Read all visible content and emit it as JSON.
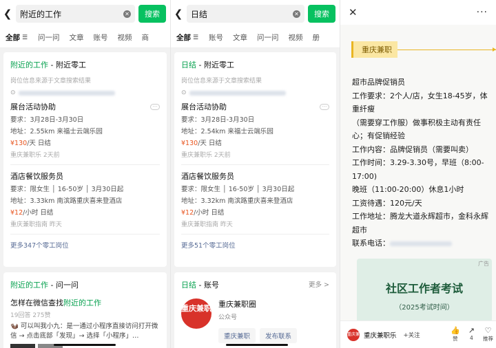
{
  "panel1": {
    "search": {
      "query": "附近的工作",
      "button": "搜索"
    },
    "tabs": [
      "全部",
      "问一问",
      "文章",
      "账号",
      "视频",
      "商"
    ],
    "card1": {
      "title_green": "附近的工作",
      "title_rest": " - 附近零工",
      "note": "岗位信息来源于文章搜索结果",
      "jobs": [
        {
          "title": "展台活动协助",
          "req": "要求：3月28日-3月30日",
          "addr": "地址：2.55km 来福士云端乐园",
          "price": "¥130",
          "unit": "/天 日结",
          "source": "重庆兼职乐 2天前"
        },
        {
          "title": "酒店餐饮服务员",
          "req": "要求：限女生 │ 16-50岁 │ 3月30日起",
          "addr": "地址：3.33km 南滨路重庆喜来登酒店",
          "price": "¥12",
          "unit": "/小时 日结",
          "source": "重庆兼职指南 昨天"
        }
      ],
      "more": "更多347个零工岗位"
    },
    "card2": {
      "title_green": "附近的工作",
      "title_rest": " - 问一问",
      "question": "怎样在微信查找",
      "question_green": "附近的工作",
      "meta": "19回答 275赞",
      "body": "🦦 可以叫我小九：是一通过小程序直接访问打开微信 → 点击底部「发现」→ 选择「小程序」…"
    }
  },
  "panel2": {
    "search": {
      "query": "日结",
      "button": "搜索"
    },
    "tabs": [
      "全部",
      "账号",
      "文章",
      "问一问",
      "视频",
      "册"
    ],
    "card1": {
      "title_green": "日结",
      "title_rest": " - 附近零工",
      "note": "岗位信息来源于文章搜索结果",
      "jobs": [
        {
          "title": "展台活动协助",
          "req": "要求：3月28日-3月30日",
          "addr": "地址：2.54km 来福士云端乐园",
          "price": "¥130",
          "unit": "/天 日结",
          "source": "重庆兼职乐 2天前"
        },
        {
          "title": "酒店餐饮服务员",
          "req": "要求：限女生 │ 16-50岁 │ 3月30日起",
          "addr": "地址：3.32km 南滨路重庆喜来登酒店",
          "price": "¥12",
          "unit": "/小时 日结",
          "source": "重庆兼职指南 昨天"
        }
      ],
      "more": "更多51个零工岗位"
    },
    "card2": {
      "title_green": "日结",
      "title_rest": " - 账号",
      "more": "更多 >",
      "logo": "重庆兼职",
      "name": "重庆兼职圈",
      "type": "公众号",
      "chips": [
        "重庆兼职",
        "发布联系"
      ]
    }
  },
  "panel3": {
    "banner": "重庆兼职",
    "lines": [
      "超市品牌促销员",
      "工作要求：2个人/店，女生18-45岁，体重纤瘦",
      "（需要穿工作服）做事积极主动有责任心；有促销经验",
      "工作内容：品牌促销员（需要叫卖）",
      "工作时间：3.29-3.30号，早班（8:00-17:00)",
      "晚班（11:00-20:00）休息1小时",
      "工资待遇：120元/天",
      "工作地址：腾龙大道永辉超市，金科永辉超市",
      "联系电话："
    ],
    "ad": {
      "tag": "广告",
      "title": "社区工作者考试",
      "subtitle": "（2025考试时间）"
    },
    "bottom": {
      "avatar": "重庆兼职",
      "name": "重庆兼职乐",
      "follow": "+关注",
      "actions": [
        {
          "icon": "👍",
          "label": "赞"
        },
        {
          "icon": "↗",
          "label": "4"
        },
        {
          "icon": "♡",
          "label": "推荐"
        }
      ]
    }
  }
}
